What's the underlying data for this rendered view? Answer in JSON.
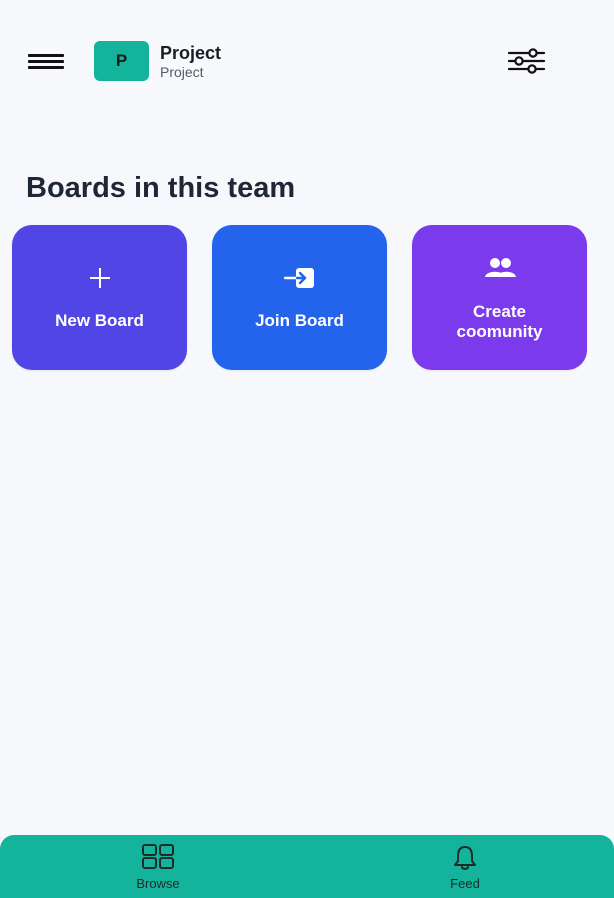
{
  "header": {
    "team_initial": "P",
    "team_name": "Project",
    "team_subtitle": "Project",
    "menu_icon": "hamburger-menu-icon",
    "filter_icon": "sliders-icon"
  },
  "main": {
    "section_title": "Boards in this team",
    "cards": [
      {
        "label": "New Board",
        "icon": "plus-icon",
        "color": "#5146e5"
      },
      {
        "label": "Join Board",
        "icon": "enter-icon",
        "color": "#2463eb"
      },
      {
        "label_line1": "Create",
        "label_line2": "coomunity",
        "icon": "users-icon",
        "color": "#7c3aed"
      }
    ]
  },
  "bottom_nav": {
    "items": [
      {
        "label": "Browse",
        "icon": "grid-icon"
      },
      {
        "label": "Feed",
        "icon": "bell-icon"
      }
    ]
  },
  "colors": {
    "accent": "#14b39b",
    "background": "#f6f8fb"
  }
}
